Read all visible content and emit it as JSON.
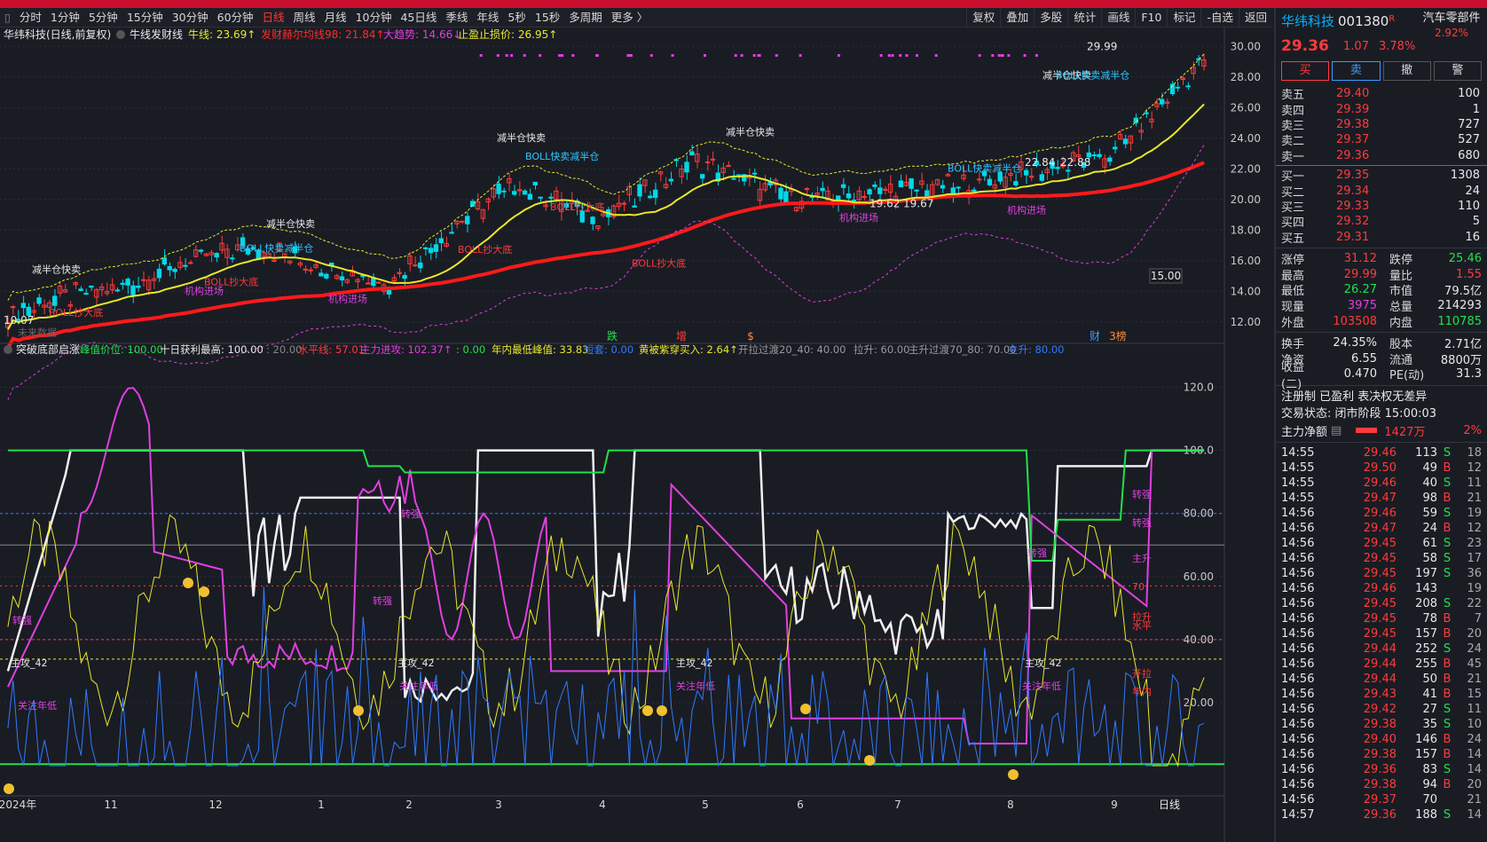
{
  "toolbar": {
    "items": [
      "分时",
      "1分钟",
      "5分钟",
      "15分钟",
      "30分钟",
      "60分钟",
      "日线",
      "周线",
      "月线",
      "10分钟",
      "45日线",
      "季线",
      "年线",
      "5秒",
      "15秒",
      "多周期",
      "更多 〉"
    ],
    "right_items": [
      "复权",
      "叠加",
      "多股",
      "统计",
      "画线",
      "F10",
      "标记",
      "-自选",
      "返回"
    ]
  },
  "main_chart": {
    "title": "华纬科技(日线,前复权)",
    "indicator_name": "牛线发财线",
    "legend": [
      {
        "label": "牛线: 23.69↑",
        "color": "#e8e82a"
      },
      {
        "label": "发财赫尔均线98: 21.84↑",
        "color": "#ff2a2a"
      },
      {
        "label": "大趋势: 14.66↓",
        "color": "#e040e0"
      },
      {
        "label": "止盈止损价: 26.95↑",
        "color": "#e8e82a"
      }
    ],
    "y_ticks": [
      "30.00",
      "28.00",
      "26.00",
      "24.00",
      "22.00",
      "20.00",
      "18.00",
      "16.00",
      "14.00",
      "12.00"
    ],
    "price_tag": "15.00",
    "annotations": {
      "high": "29.99",
      "low": "10.07",
      "mid1": "22.84",
      "mid2": "22.88",
      "mid3": "19.62",
      "mid4": "19.67"
    },
    "signal_labels": [
      "减半仓快卖",
      "BOLL快卖减半仓",
      "BOLL抄大底",
      "机构进场"
    ],
    "event_markers": [
      "跌",
      "增",
      "$",
      "财",
      "3榜"
    ],
    "no_data_label": "未来数据"
  },
  "sub_chart": {
    "title": "突破底部启涨",
    "legend": [
      {
        "label": "峰值价位: 100.00",
        "color": "#22e04a"
      },
      {
        "label": "十日获利最高: 100.00",
        "color": "#e8e8e8"
      },
      {
        "label": ": 20.00",
        "color": "#888888"
      },
      {
        "label": "水平线: 57.01",
        "color": "#ff3b3b"
      },
      {
        "label": "主力进攻: 102.37↑",
        "color": "#e040e0"
      },
      {
        "label": ": 0.00",
        "color": "#22e04a"
      },
      {
        "label": "年内最低峰值: 33.83",
        "color": "#e8e82a"
      },
      {
        "label": "短套: 0.00",
        "color": "#2e7bff"
      },
      {
        "label": "黄被紫穿买入: 2.64↑",
        "color": "#e8e82a"
      },
      {
        "label": "开拉过渡20_40: 40.00",
        "color": "#999999"
      },
      {
        "label": "拉升: 60.00",
        "color": "#999999"
      },
      {
        "label": "主升过渡70_80: 70.00",
        "color": "#999999"
      },
      {
        "label": "主升: 80.00",
        "color": "#2e7bff"
      }
    ],
    "y_ticks": [
      "120.0",
      "100.0",
      "80.00",
      "60.00",
      "40.00",
      "20.00"
    ],
    "labels": [
      "主攻_42",
      "关注年低",
      "转强"
    ],
    "right_labels": [
      "转强",
      "主升",
      "70",
      "拉升",
      "水平",
      "开拉",
      "年内"
    ]
  },
  "x_axis": {
    "labels": [
      "2024年",
      "11",
      "12",
      "1",
      "2",
      "3",
      "4",
      "5",
      "6",
      "7",
      "8",
      "9"
    ],
    "period": "日线"
  },
  "quote": {
    "name": "华纬科技",
    "code": "001380",
    "badge": "R",
    "industry": "汽车零部件",
    "industry_pct": "2.92%",
    "price": "29.36",
    "change": "1.07",
    "change_pct": "3.78%",
    "buttons": [
      "买",
      "卖",
      "撤",
      "警"
    ],
    "asks": [
      {
        "label": "卖五",
        "price": "29.40",
        "vol": "100"
      },
      {
        "label": "卖四",
        "price": "29.39",
        "vol": "1"
      },
      {
        "label": "卖三",
        "price": "29.38",
        "vol": "727"
      },
      {
        "label": "卖二",
        "price": "29.37",
        "vol": "527"
      },
      {
        "label": "卖一",
        "price": "29.36",
        "vol": "680"
      }
    ],
    "bids": [
      {
        "label": "买一",
        "price": "29.35",
        "vol": "1308"
      },
      {
        "label": "买二",
        "price": "29.34",
        "vol": "24"
      },
      {
        "label": "买三",
        "price": "29.33",
        "vol": "110"
      },
      {
        "label": "买四",
        "price": "29.32",
        "vol": "5"
      },
      {
        "label": "买五",
        "price": "29.31",
        "vol": "16"
      }
    ],
    "stats": [
      {
        "l1": "涨停",
        "v1": "31.12",
        "c1": "red",
        "l2": "跌停",
        "v2": "25.46",
        "c2": "green"
      },
      {
        "l1": "最高",
        "v1": "29.99",
        "c1": "red",
        "l2": "量比",
        "v2": "1.55",
        "c2": "red"
      },
      {
        "l1": "最低",
        "v1": "26.27",
        "c1": "green",
        "l2": "市值",
        "v2": "79.5亿",
        "c2": "wht"
      },
      {
        "l1": "现量",
        "v1": "3975",
        "c1": "mag",
        "l2": "总量",
        "v2": "214293",
        "c2": "wht"
      },
      {
        "l1": "外盘",
        "v1": "103508",
        "c1": "red",
        "l2": "内盘",
        "v2": "110785",
        "c2": "green"
      }
    ],
    "stats2": [
      {
        "l1": "换手",
        "v1": "24.35%",
        "c1": "wht",
        "l2": "股本",
        "v2": "2.71亿",
        "c2": "wht"
      },
      {
        "l1": "净资",
        "v1": "6.55",
        "c1": "wht",
        "l2": "流通",
        "v2": "8800万",
        "c2": "wht"
      },
      {
        "l1": "收益(二)",
        "v1": "0.470",
        "c1": "wht",
        "l2": "PE(动)",
        "v2": "31.3",
        "c2": "wht"
      }
    ],
    "notes": [
      "注册制 已盈利 表决权无差异",
      "交易状态: 闭市阶段 15:00:03"
    ],
    "flow_label": "主力净额",
    "flow_value": "1427万",
    "flow_pct": "2%"
  },
  "trades": [
    {
      "t": "14:55",
      "p": "29.46",
      "v": "113",
      "s": "S",
      "n": "18"
    },
    {
      "t": "14:55",
      "p": "29.50",
      "v": "49",
      "s": "B",
      "n": "12"
    },
    {
      "t": "14:55",
      "p": "29.46",
      "v": "40",
      "s": "S",
      "n": "11"
    },
    {
      "t": "14:55",
      "p": "29.47",
      "v": "98",
      "s": "B",
      "n": "21"
    },
    {
      "t": "14:56",
      "p": "29.46",
      "v": "59",
      "s": "S",
      "n": "19"
    },
    {
      "t": "14:56",
      "p": "29.47",
      "v": "24",
      "s": "B",
      "n": "12"
    },
    {
      "t": "14:56",
      "p": "29.45",
      "v": "61",
      "s": "S",
      "n": "23"
    },
    {
      "t": "14:56",
      "p": "29.45",
      "v": "58",
      "s": "S",
      "n": "17"
    },
    {
      "t": "14:56",
      "p": "29.45",
      "v": "197",
      "s": "S",
      "n": "36"
    },
    {
      "t": "14:56",
      "p": "29.46",
      "v": "143",
      "s": "",
      "n": "19"
    },
    {
      "t": "14:56",
      "p": "29.45",
      "v": "208",
      "s": "S",
      "n": "22"
    },
    {
      "t": "14:56",
      "p": "29.45",
      "v": "78",
      "s": "B",
      "n": "7"
    },
    {
      "t": "14:56",
      "p": "29.45",
      "v": "157",
      "s": "B",
      "n": "20"
    },
    {
      "t": "14:56",
      "p": "29.44",
      "v": "252",
      "s": "S",
      "n": "24"
    },
    {
      "t": "14:56",
      "p": "29.44",
      "v": "255",
      "s": "B",
      "n": "45"
    },
    {
      "t": "14:56",
      "p": "29.44",
      "v": "50",
      "s": "B",
      "n": "21"
    },
    {
      "t": "14:56",
      "p": "29.43",
      "v": "41",
      "s": "B",
      "n": "15"
    },
    {
      "t": "14:56",
      "p": "29.42",
      "v": "27",
      "s": "S",
      "n": "11"
    },
    {
      "t": "14:56",
      "p": "29.38",
      "v": "35",
      "s": "S",
      "n": "10"
    },
    {
      "t": "14:56",
      "p": "29.40",
      "v": "146",
      "s": "B",
      "n": "24"
    },
    {
      "t": "14:56",
      "p": "29.38",
      "v": "157",
      "s": "B",
      "n": "14"
    },
    {
      "t": "14:56",
      "p": "29.36",
      "v": "83",
      "s": "S",
      "n": "14"
    },
    {
      "t": "14:56",
      "p": "29.38",
      "v": "94",
      "s": "B",
      "n": "20"
    },
    {
      "t": "14:56",
      "p": "29.37",
      "v": "70",
      "s": "",
      "n": "21"
    },
    {
      "t": "14:57",
      "p": "29.36",
      "v": "188",
      "s": "S",
      "n": "14"
    }
  ]
}
